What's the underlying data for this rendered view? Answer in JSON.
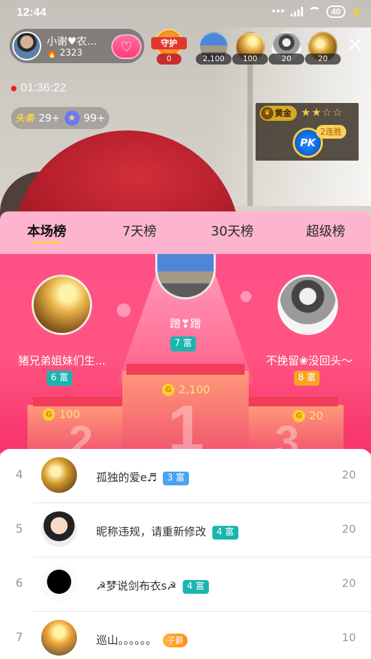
{
  "status_bar": {
    "time": "12:44",
    "battery": "40"
  },
  "host": {
    "name": "小谢♥农...",
    "heat": "2323"
  },
  "guard": {
    "label": "守护",
    "count": "0"
  },
  "viewers": [
    {
      "score": "2,100"
    },
    {
      "score": "100"
    },
    {
      "score": "20"
    },
    {
      "score": "20"
    }
  ],
  "live": {
    "timer": "01:36:22"
  },
  "chips": {
    "headline": "头条",
    "headline_count": "29+",
    "star_count": "99+"
  },
  "pk": {
    "tier": "黄金",
    "stars": "★★☆☆",
    "button": "PK",
    "streak": "2连胜"
  },
  "tabs": [
    "本场榜",
    "7天榜",
    "30天榜",
    "超级榜"
  ],
  "podium": {
    "first": {
      "name": "蹭❣蹭",
      "wealth": "7 富",
      "score": "2,100",
      "block": "1"
    },
    "second": {
      "name": "猪兄弟姐妹们生...",
      "wealth": "6 富",
      "score": "100",
      "block": "2"
    },
    "third": {
      "name": "不挽留❀没回头～",
      "wealth": "8 富",
      "score": "20",
      "block": "3"
    }
  },
  "list": [
    {
      "rank": "4",
      "name": "孤独的爱e♬",
      "tag": "3 富",
      "score": "20"
    },
    {
      "rank": "5",
      "name": "昵称违规，请重新修改",
      "tag": "4 富",
      "score": "20"
    },
    {
      "rank": "6",
      "name": "☭梦说剑布衣s☭",
      "tag": "4 富",
      "score": "20"
    },
    {
      "rank": "7",
      "name": "巡山。。。。。。",
      "tag": "子爵",
      "score": "10"
    }
  ],
  "colors": {
    "accent_pink": "#ff4f86",
    "tab_bg": "#fdb5cf",
    "teal_tag": "#1bb5b0",
    "gold_tag": "#f6a623"
  }
}
